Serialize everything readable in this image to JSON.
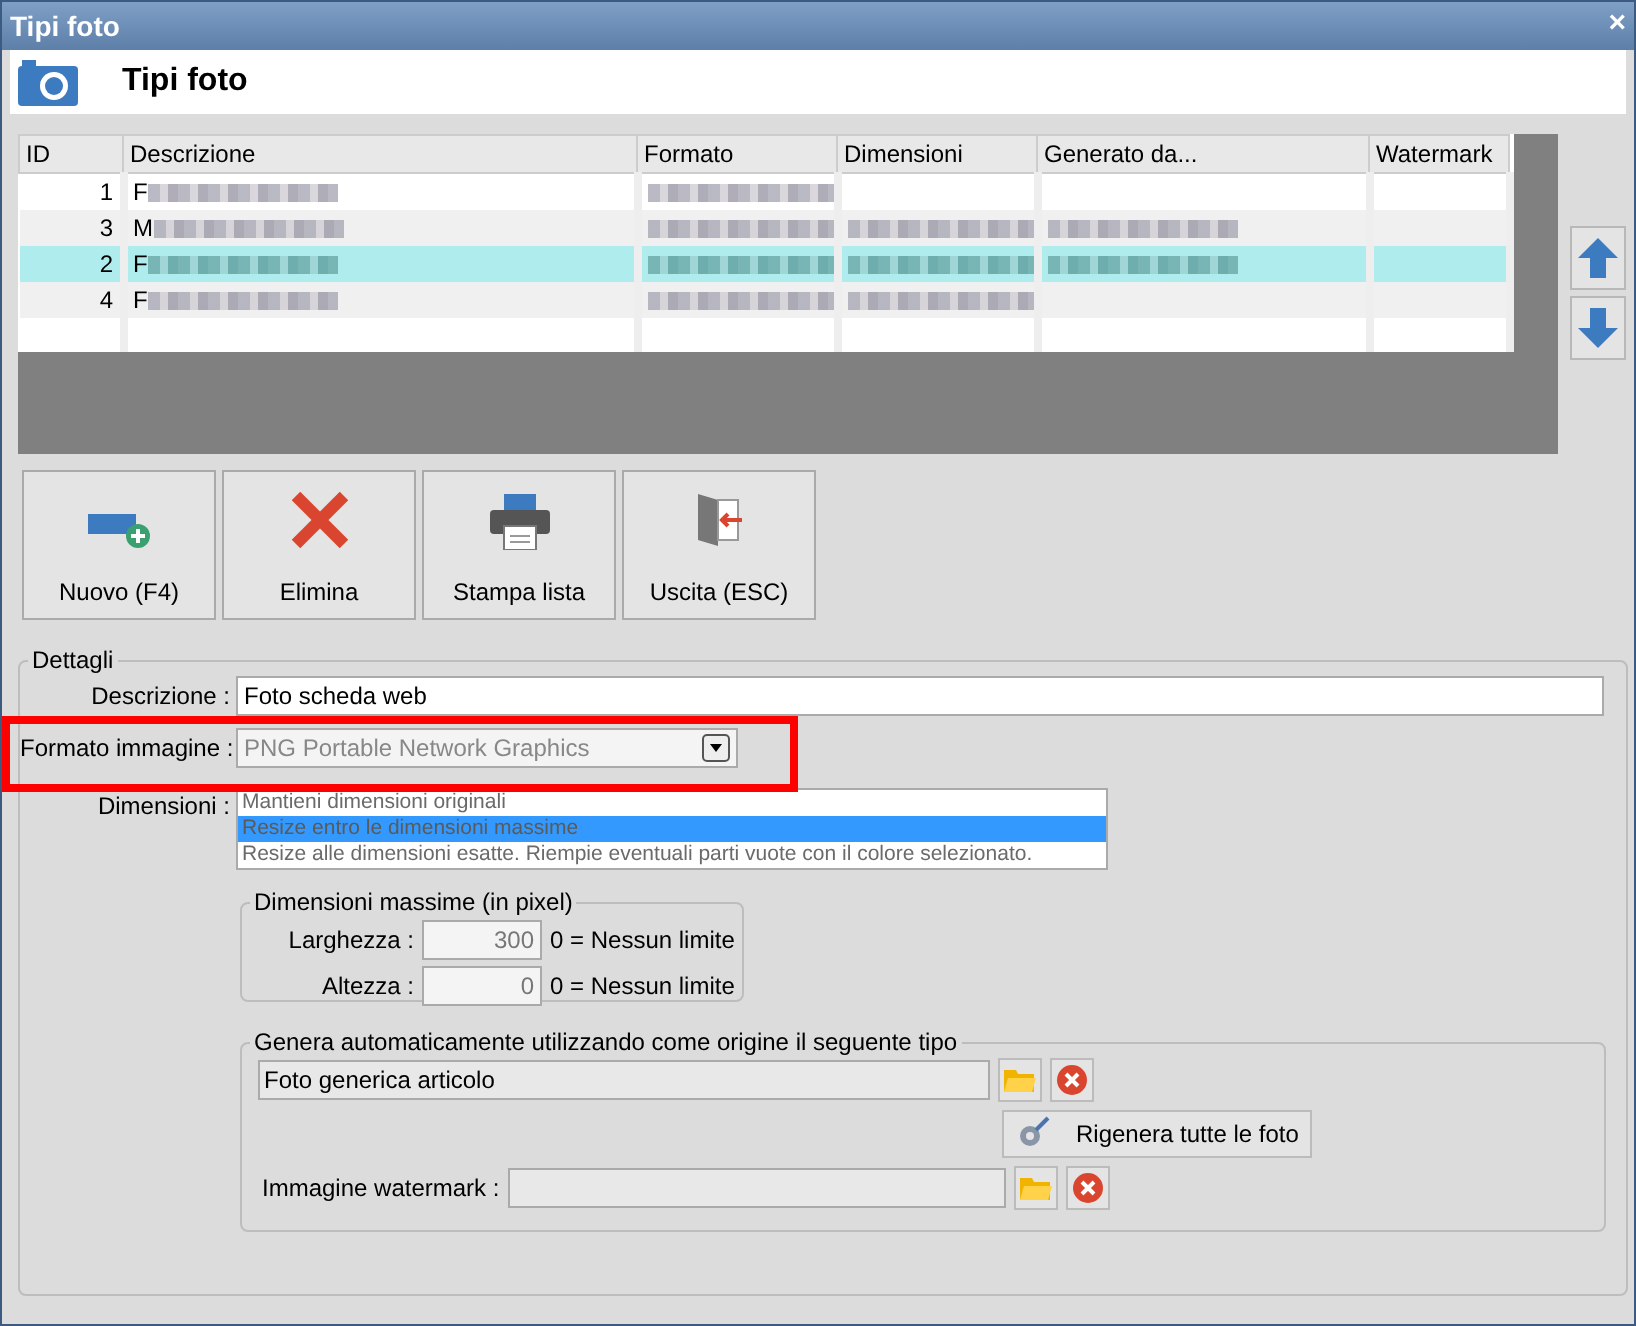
{
  "window": {
    "title": "Tipi foto",
    "close": "×"
  },
  "header": {
    "title": "Tipi foto"
  },
  "table": {
    "columns": [
      "ID",
      "Descrizione",
      "Formato",
      "Dimensioni",
      "Generato da...",
      "Watermark"
    ],
    "rows": [
      {
        "selected": false,
        "cells": [
          {
            "text": "1",
            "blurred": false
          },
          {
            "text": "F",
            "blurred": true
          },
          {
            "blurred": true
          },
          {
            "blurred": false
          },
          {
            "blurred": false
          },
          {
            "blurred": false
          }
        ]
      },
      {
        "selected": false,
        "cells": [
          {
            "text": "3",
            "blurred": false
          },
          {
            "text": "M",
            "blurred": true
          },
          {
            "blurred": true
          },
          {
            "blurred": true
          },
          {
            "blurred": true
          },
          {
            "blurred": false
          }
        ]
      },
      {
        "selected": true,
        "cells": [
          {
            "text": "2",
            "blurred": false
          },
          {
            "text": "F",
            "blurred": true
          },
          {
            "blurred": true
          },
          {
            "blurred": true
          },
          {
            "blurred": true
          },
          {
            "blurred": false
          }
        ]
      },
      {
        "selected": false,
        "cells": [
          {
            "text": "4",
            "blurred": false
          },
          {
            "text": "F",
            "blurred": true
          },
          {
            "blurred": true
          },
          {
            "blurred": true
          },
          {
            "blurred": false
          },
          {
            "blurred": false
          }
        ]
      }
    ]
  },
  "toolbar": [
    {
      "kind": "new",
      "label": "Nuovo (F4)"
    },
    {
      "kind": "delete",
      "label": "Elimina"
    },
    {
      "kind": "print",
      "label": "Stampa lista"
    },
    {
      "kind": "exit",
      "label": "Uscita (ESC)"
    }
  ],
  "details": {
    "legend": "Dettagli",
    "descrizione": {
      "label": "Descrizione :",
      "value": "Foto scheda web"
    },
    "formato": {
      "label": "Formato immagine :",
      "value": "PNG Portable Network Graphics",
      "disabled": true
    },
    "dimensioni": {
      "label": "Dimensioni :",
      "options": [
        {
          "label": "Mantieni dimensioni originali",
          "selected": false
        },
        {
          "label": "Resize entro le dimensioni massime",
          "selected": true
        },
        {
          "label": "Resize alle dimensioni esatte. Riempie eventuali parti vuote con il colore selezionato.",
          "selected": false
        }
      ]
    },
    "max": {
      "legend": "Dimensioni massime (in pixel)",
      "fields": [
        {
          "label": "Larghezza :",
          "value": "300",
          "hint": "0 = Nessun limite"
        },
        {
          "label": "Altezza :",
          "value": "0",
          "hint": "0 = Nessun limite"
        }
      ]
    },
    "genera": {
      "legend": "Genera automaticamente utilizzando come origine il seguente tipo",
      "source": "Foto generica articolo",
      "regenerate": "Rigenera tutte le foto",
      "watermark_label": "Immagine watermark :"
    }
  },
  "annotation": {
    "kind": "frame"
  }
}
